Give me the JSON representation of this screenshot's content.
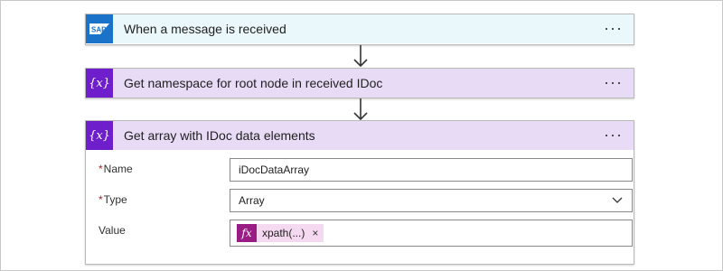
{
  "steps": [
    {
      "title": "When a message is received",
      "icon": "sap-icon",
      "icon_text": "SAP",
      "header_color": "#eaf7fb",
      "icon_color": "#1a73c9",
      "more": "···"
    },
    {
      "title": "Get namespace for root node in received IDoc",
      "icon": "variable-icon",
      "icon_text": "{x}",
      "header_color": "#e8dbf6",
      "icon_color": "#6e1fcb",
      "more": "···"
    },
    {
      "title": "Get array with IDoc data elements",
      "icon": "variable-icon",
      "icon_text": "{x}",
      "header_color": "#e8dbf6",
      "icon_color": "#6e1fcb",
      "more": "···"
    }
  ],
  "form": {
    "name": {
      "required": "*",
      "label": "Name",
      "value": "iDocDataArray"
    },
    "type": {
      "required": "*",
      "label": "Type",
      "value": "Array"
    },
    "value": {
      "label": "Value",
      "token_icon": "fx",
      "token_label": "xpath(...)",
      "token_remove": "×"
    }
  }
}
